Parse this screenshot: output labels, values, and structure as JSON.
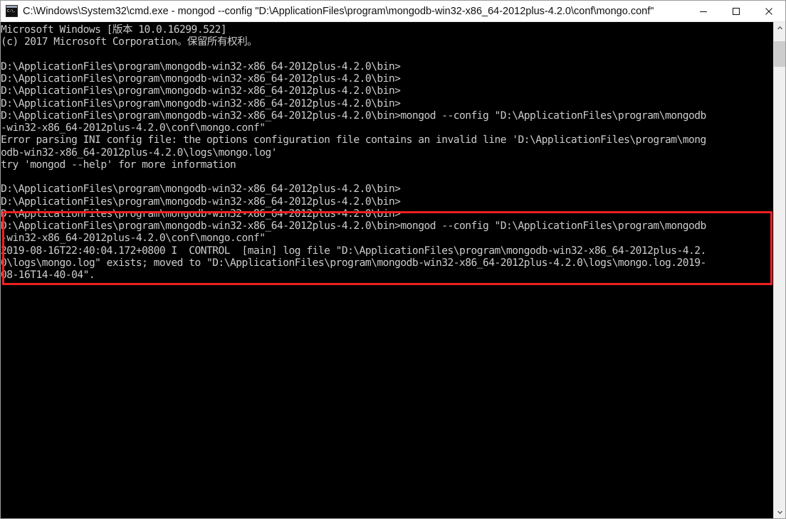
{
  "window": {
    "title": "C:\\Windows\\System32\\cmd.exe - mongod  --config \"D:\\ApplicationFiles\\program\\mongodb-win32-x86_64-2012plus-4.2.0\\conf\\mongo.conf\"",
    "icon": "cmd-console-icon",
    "controls": {
      "minimize_label": "Minimize",
      "maximize_label": "Maximize",
      "close_label": "Close"
    }
  },
  "colors": {
    "console_background": "#000000",
    "console_text": "#cccccc",
    "annotation_red": "#f02020",
    "titlebar_background": "#ffffff",
    "scrollbar_track": "#f0f0f0",
    "scrollbar_thumb": "#cdcdcd"
  },
  "console": {
    "lines": [
      "Microsoft Windows [版本 10.0.16299.522]",
      "(c) 2017 Microsoft Corporation。保留所有权利。",
      "",
      "D:\\ApplicationFiles\\program\\mongodb-win32-x86_64-2012plus-4.2.0\\bin>",
      "D:\\ApplicationFiles\\program\\mongodb-win32-x86_64-2012plus-4.2.0\\bin>",
      "D:\\ApplicationFiles\\program\\mongodb-win32-x86_64-2012plus-4.2.0\\bin>",
      "D:\\ApplicationFiles\\program\\mongodb-win32-x86_64-2012plus-4.2.0\\bin>",
      "D:\\ApplicationFiles\\program\\mongodb-win32-x86_64-2012plus-4.2.0\\bin>mongod --config \"D:\\ApplicationFiles\\program\\mongodb",
      "-win32-x86_64-2012plus-4.2.0\\conf\\mongo.conf\"",
      "Error parsing INI config file: the options configuration file contains an invalid line 'D:\\ApplicationFiles\\program\\mong",
      "odb-win32-x86_64-2012plus-4.2.0\\logs\\mongo.log'",
      "try 'mongod --help' for more information",
      "",
      "D:\\ApplicationFiles\\program\\mongodb-win32-x86_64-2012plus-4.2.0\\bin>",
      "D:\\ApplicationFiles\\program\\mongodb-win32-x86_64-2012plus-4.2.0\\bin>",
      "D:\\ApplicationFiles\\program\\mongodb-win32-x86_64-2012plus-4.2.0\\bin>",
      "D:\\ApplicationFiles\\program\\mongodb-win32-x86_64-2012plus-4.2.0\\bin>mongod --config \"D:\\ApplicationFiles\\program\\mongodb",
      "-win32-x86_64-2012plus-4.2.0\\conf\\mongo.conf\"",
      "2019-08-16T22:40:04.172+0800 I  CONTROL  [main] log file \"D:\\ApplicationFiles\\program\\mongodb-win32-x86_64-2012plus-4.2.",
      "0\\logs\\mongo.log\" exists; moved to \"D:\\ApplicationFiles\\program\\mongodb-win32-x86_64-2012plus-4.2.0\\logs\\mongo.log.2019-",
      "08-16T14-40-04\"."
    ]
  },
  "annotation": {
    "name": "red-highlight-box",
    "covers_lines_from": 16,
    "covers_lines_to": 20
  },
  "scrollbar": {
    "up_arrow": "chevron-up-icon",
    "down_arrow": "chevron-down-icon"
  }
}
